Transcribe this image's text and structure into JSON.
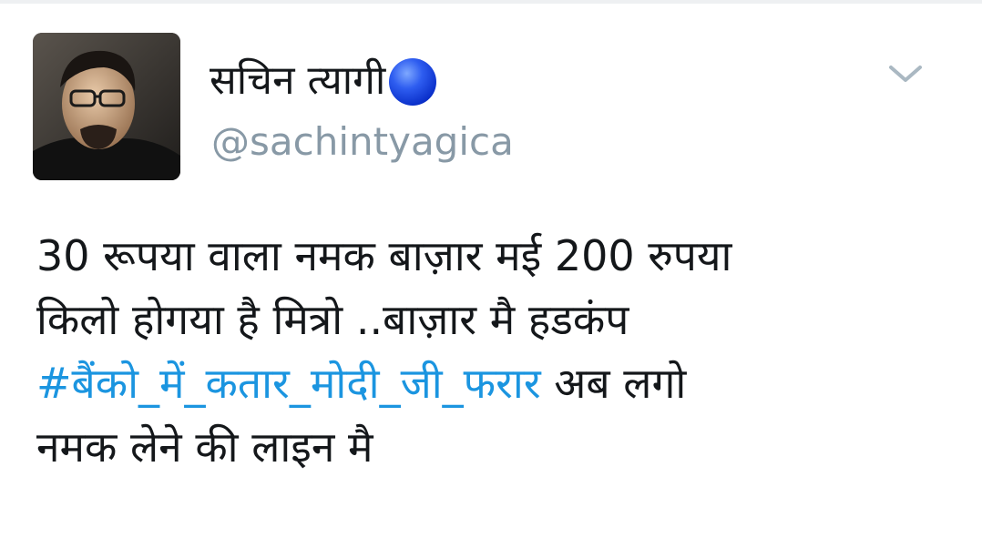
{
  "tweet": {
    "author": {
      "display_name": "सचिन त्यागी",
      "handle": "@sachintyagica",
      "status_icon": "blue-circle-icon",
      "status_color": "#1d4be0"
    },
    "menu_icon": "chevron-down-icon",
    "text_lines": {
      "l1": "30 रूपया वाला नमक बाज़ार मई 200 रुपया",
      "l2": "किलो होगया है मित्रो ..बाज़ार मै हडकंप",
      "l3_hashtag": "#बैंको_में_कतार_मोदी_जी_फरार",
      "l3_rest": " अब लगो",
      "l4": "नमक लेने की लाइन मै"
    },
    "colors": {
      "text": "#14171a",
      "handle": "#8899a6",
      "hashtag": "#1b95e0"
    }
  }
}
